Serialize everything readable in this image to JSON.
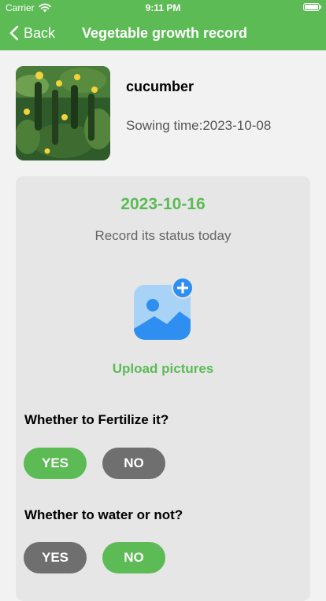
{
  "status_bar": {
    "carrier": "Carrier",
    "time": "9:11 PM"
  },
  "nav": {
    "back_label": "Back",
    "title": "Vegetable growth record"
  },
  "plant": {
    "name": "cucumber",
    "sowing_time": "Sowing time:2023-10-08"
  },
  "record": {
    "date": "2023-10-16",
    "hint": "Record its status today",
    "upload_label": "Upload pictures"
  },
  "fertilize": {
    "question": "Whether to Fertilize it?",
    "yes_label": "YES",
    "no_label": "NO",
    "selected": "YES"
  },
  "water": {
    "question": "Whether to water or not?",
    "yes_label": "YES",
    "no_label": "NO",
    "selected": "NO"
  },
  "colors": {
    "accent": "#5cbb55",
    "inactive": "#6f6f6f",
    "upload_icon": "#2f8ff0"
  },
  "icons": {
    "back": "chevron-left-icon",
    "upload": "image-add-icon",
    "wifi": "wifi-icon",
    "battery": "battery-icon"
  }
}
